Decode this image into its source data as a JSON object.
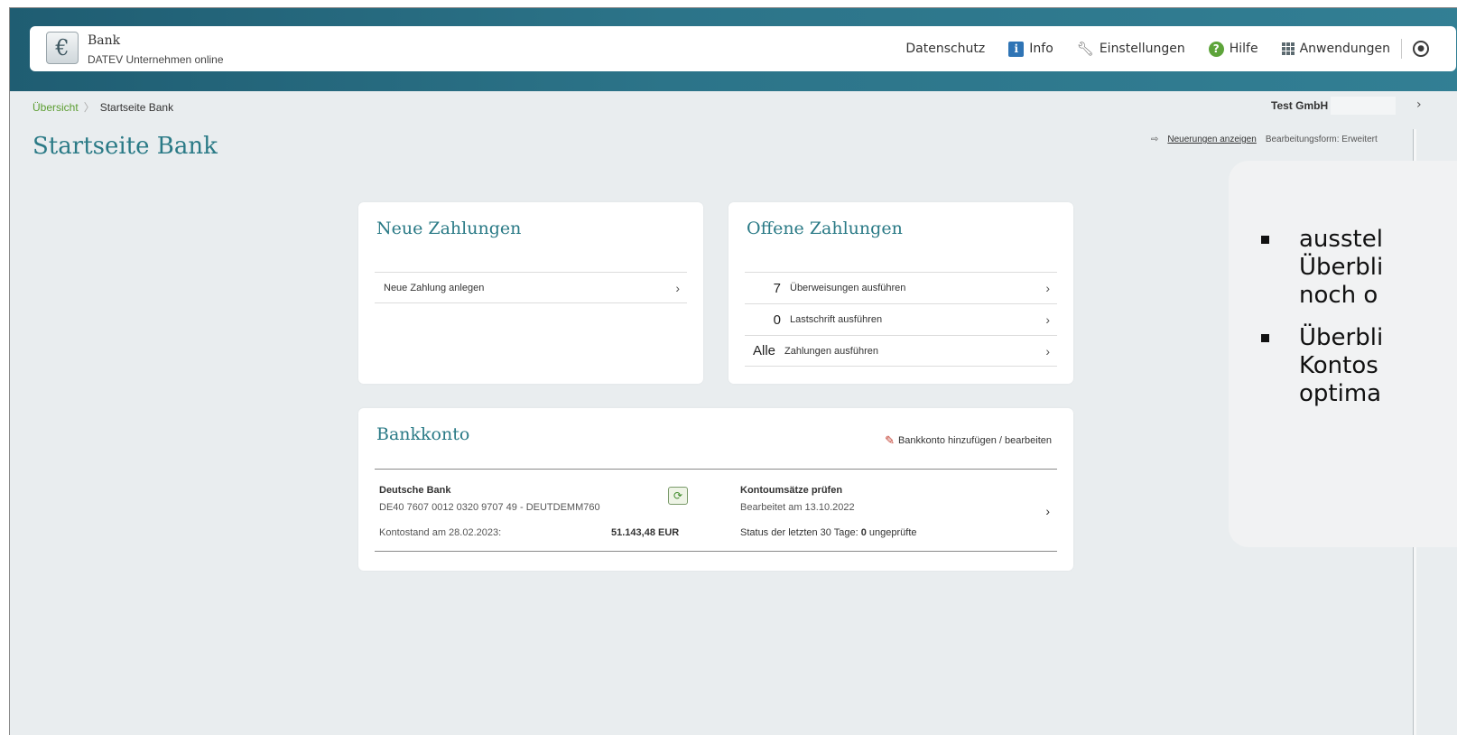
{
  "header": {
    "app_title": "Bank",
    "app_subtitle": "DATEV Unternehmen online",
    "logo_symbol": "€",
    "nav": [
      {
        "label": "Datenschutz",
        "icon": ""
      },
      {
        "label": "Info",
        "icon": "info-icon"
      },
      {
        "label": "Einstellungen",
        "icon": "wrench-icon"
      },
      {
        "label": "Hilfe",
        "icon": "help-icon"
      },
      {
        "label": "Anwendungen",
        "icon": "apps-grid-icon"
      }
    ],
    "user_icon": "user-icon"
  },
  "breadcrumb": {
    "root": "Übersicht",
    "current": "Startseite Bank"
  },
  "company": "Test GmbH",
  "page_title": "Startseite Bank",
  "news": {
    "link": "Neuerungen anzeigen",
    "mode": "Bearbeitungsform: Erweitert"
  },
  "neue_zahlungen": {
    "title": "Neue Zahlungen",
    "rows": [
      {
        "label": "Neue Zahlung anlegen"
      }
    ]
  },
  "offene_zahlungen": {
    "title": "Offene Zahlungen",
    "rows": [
      {
        "count": "7",
        "label": "Überweisungen ausführen"
      },
      {
        "count": "0",
        "label": "Lastschrift ausführen"
      },
      {
        "count": "Alle",
        "label": "Zahlungen ausführen"
      }
    ]
  },
  "bankkonto": {
    "title": "Bankkonto",
    "edit_label": "Bankkonto hinzufügen / bearbeiten",
    "bank_name": "Deutsche Bank",
    "iban": "DE40 7607 0012 0320 9707 49 - DEUTDEMM760",
    "balance_label": "Kontostand am 28.02.2023:",
    "balance_value": "51.143,48 EUR",
    "check_title": "Kontoumsätze prüfen",
    "edited": "Bearbeitet am 13.10.2022",
    "status_prefix": "Status der letzten 30 Tage: ",
    "status_count": "0",
    "status_suffix": " ungeprüfte"
  },
  "overlay": {
    "bullets": [
      [
        "ausstel",
        "Überbli",
        "noch o"
      ],
      [
        "Überbli",
        "Kontos",
        "optima"
      ]
    ]
  },
  "colors": {
    "accent": "#2a7a86",
    "band": "#2c7489",
    "link_green": "#5b9d30"
  }
}
